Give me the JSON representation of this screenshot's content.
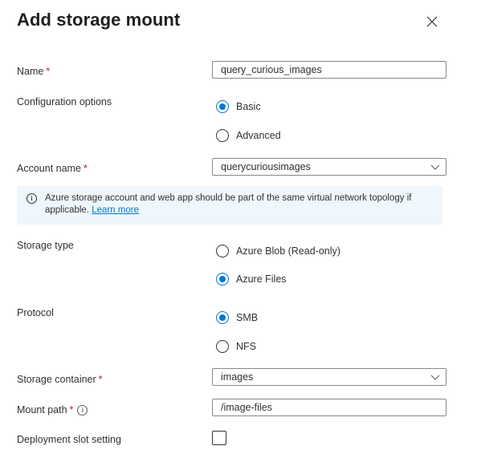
{
  "panel": {
    "title": "Add storage mount"
  },
  "fields": {
    "name": {
      "label": "Name",
      "required_mark": "*",
      "value": "query_curious_images"
    },
    "config": {
      "label": "Configuration options",
      "options": [
        {
          "label": "Basic",
          "selected": true
        },
        {
          "label": "Advanced",
          "selected": false
        }
      ]
    },
    "account": {
      "label": "Account name",
      "required_mark": "*",
      "value": "querycuriousimages"
    },
    "info": {
      "text": "Azure storage account and web app should be part of the same virtual network topology if applicable.",
      "link": "Learn more"
    },
    "storage_type": {
      "label": "Storage type",
      "options": [
        {
          "label": "Azure Blob (Read-only)",
          "selected": false
        },
        {
          "label": "Azure Files",
          "selected": true
        }
      ]
    },
    "protocol": {
      "label": "Protocol",
      "options": [
        {
          "label": "SMB",
          "selected": true
        },
        {
          "label": "NFS",
          "selected": false
        }
      ]
    },
    "container": {
      "label": "Storage container",
      "required_mark": "*",
      "value": "images"
    },
    "mount_path": {
      "label": "Mount path",
      "required_mark": "*",
      "value": "/image-files"
    },
    "slot_setting": {
      "label": "Deployment slot setting",
      "checked": false
    }
  },
  "colors": {
    "accent": "#0078d4",
    "required": "#a4262c",
    "info_bg": "#eff6fc"
  },
  "icons": {
    "close": "close-icon",
    "chevron": "chevron-down-icon",
    "info": "info-icon"
  }
}
